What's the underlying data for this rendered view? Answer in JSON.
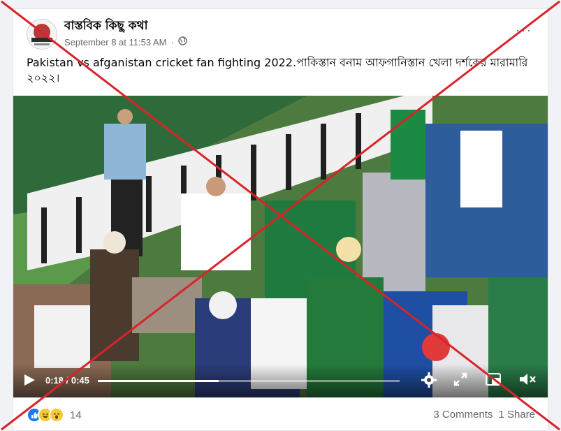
{
  "post": {
    "page_name": "বাস্তবিক কিছু কথা",
    "timestamp": "September 8 at 11:53 AM",
    "separator": "·",
    "audience_icon": "globe-icon",
    "more_label": "···",
    "caption": "Pakistan vs afganistan cricket fan fighting 2022.পাকিস্তান বনাম আফগানিস্তান খেলা দর্শকের মারামারি ২০২২।"
  },
  "video": {
    "current_time": "0:18",
    "duration": "0:45",
    "time_separator": " / ",
    "progress": 0.4,
    "icons": [
      "play-icon",
      "settings-icon",
      "fullscreen-icon",
      "pip-icon",
      "volume-muted-icon"
    ]
  },
  "footer": {
    "reactions": [
      "like-icon",
      "haha-icon",
      "wow-icon"
    ],
    "reaction_count": "14",
    "comments": "3 Comments",
    "shares": "1 Share"
  },
  "colors": {
    "cross": "#d8232a",
    "like": "#1877f2",
    "reaction_yellow": "#f7c935"
  }
}
